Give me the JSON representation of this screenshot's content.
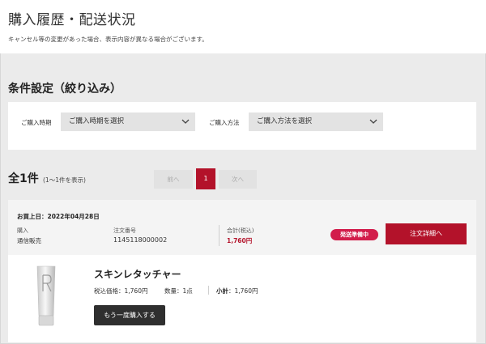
{
  "header": {
    "title": "購入履歴・配送状況",
    "note": "キャンセル等の変更があった場合、表示内容が異なる場合がございます。"
  },
  "filter": {
    "title": "条件設定（絞り込み）",
    "period_label": "ご購入時期",
    "period_value": "ご購入時期を選択",
    "method_label": "ご購入方法",
    "method_value": "ご購入方法を選択"
  },
  "results": {
    "count_title": "全1件",
    "count_sub": "(1〜1件を表示)",
    "prev_label": "前へ",
    "page_number": "1",
    "next_label": "次へ"
  },
  "order": {
    "date_text": "お買上日：2022年04月28日",
    "purchase_label": "購入",
    "purchase_value": "通信販売",
    "order_no_label": "注文番号",
    "order_no_value": "1145118000002",
    "total_label": "合計(税込)",
    "total_value": "1,760円",
    "status_badge": "発送準備中",
    "detail_button": "注文詳細へ",
    "accent_color": "#b3122a",
    "badge_color": "#d21d4b"
  },
  "product": {
    "name": "スキンレタッチャー",
    "price_text": "税込価格：1,760円",
    "qty_text": "数量：1点",
    "subtotal_label": "小計",
    "subtotal_value": "：1,760円",
    "rebuy_button": "もう一度購入する",
    "image_icon": "product-tube-image"
  }
}
